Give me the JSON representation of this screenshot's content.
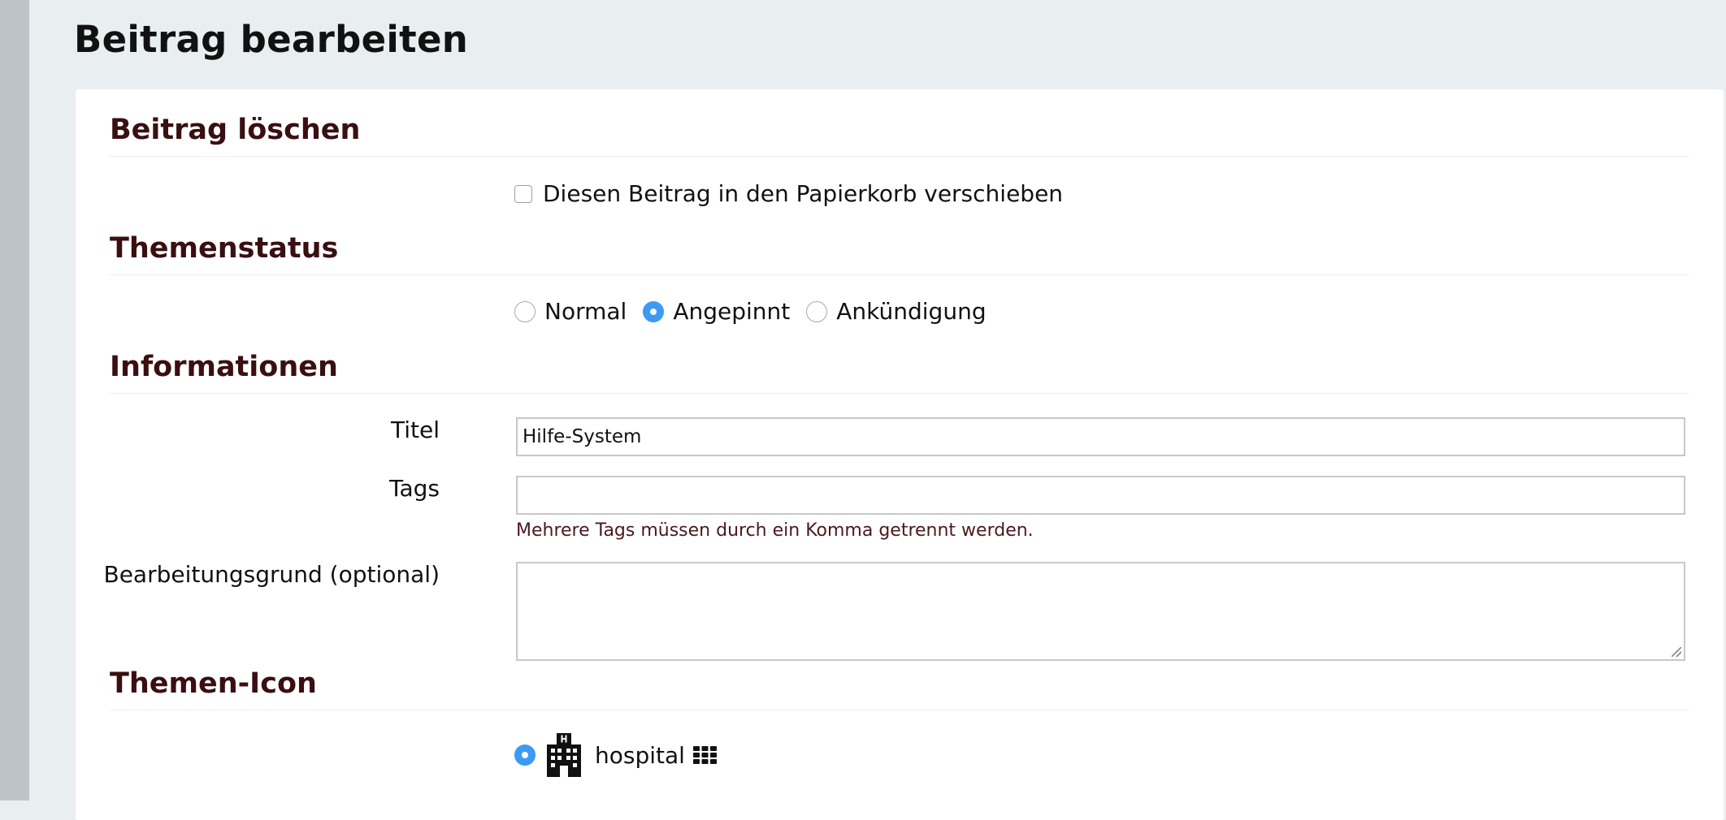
{
  "page": {
    "title": "Beitrag bearbeiten"
  },
  "sections": {
    "delete": {
      "title": "Beitrag löschen",
      "checkbox_label": "Diesen Beitrag in den Papierkorb verschieben",
      "checked": false
    },
    "status": {
      "title": "Themenstatus",
      "options": [
        {
          "label": "Normal",
          "selected": false
        },
        {
          "label": "Angepinnt",
          "selected": true
        },
        {
          "label": "Ankündigung",
          "selected": false
        }
      ]
    },
    "info": {
      "title": "Informationen",
      "title_label": "Titel",
      "title_value": "Hilfe-System",
      "tags_label": "Tags",
      "tags_value": "",
      "tags_hint": "Mehrere Tags müssen durch ein Komma getrennt werden.",
      "reason_label": "Bearbeitungsgrund (optional)",
      "reason_value": ""
    },
    "icon": {
      "title": "Themen-Icon",
      "selected_icon_label": "hospital",
      "selected_icon": "hospital-icon",
      "picker_icon": "grid-icon"
    }
  },
  "colors": {
    "page_background": "#e9eef0",
    "left_strip": "#bdc3c7",
    "panel_background": "#ffffff",
    "section_title": "#3a0f12",
    "radio_selected": "#3d9af2",
    "hint_text": "#4a1a1e"
  }
}
